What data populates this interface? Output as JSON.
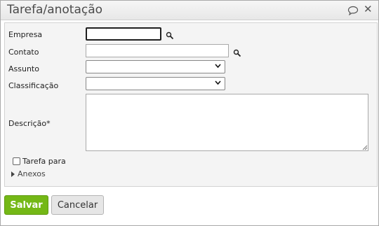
{
  "dialog": {
    "title": "Tarefa/anotação",
    "icons": {
      "chat": "speech-bubble-icon",
      "close": "close-icon"
    }
  },
  "form": {
    "empresa": {
      "label": "Empresa",
      "value": ""
    },
    "contato": {
      "label": "Contato",
      "value": ""
    },
    "assunto": {
      "label": "Assunto",
      "selected": ""
    },
    "classificacao": {
      "label": "Classificação",
      "selected": ""
    },
    "descricao": {
      "label": "Descrição*",
      "value": ""
    },
    "tarefa_para": {
      "label": "Tarefa para",
      "checked": false
    },
    "anexos": {
      "label": "Anexos"
    }
  },
  "buttons": {
    "save": "Salvar",
    "cancel": "Cancelar"
  },
  "colors": {
    "save_bg": "#74b816",
    "panel_bg": "#f4f4f4"
  }
}
